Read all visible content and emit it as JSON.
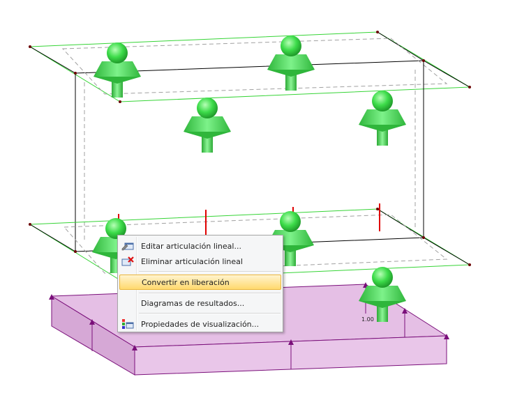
{
  "context_menu": {
    "items": [
      {
        "label": "Editar articulación lineal...",
        "icon": "edit-line-hinge-icon"
      },
      {
        "label": "Eliminar articulación lineal",
        "icon": "delete-line-hinge-icon"
      },
      {
        "label": "Convertir en liberación",
        "icon": "",
        "highlighted": true
      },
      {
        "label": "Diagramas de resultados...",
        "icon": ""
      },
      {
        "label": "Propiedades de visualización...",
        "icon": "display-properties-icon"
      }
    ]
  },
  "model": {
    "dimension_label": "1.00",
    "colors": {
      "support": "#3ddc4a",
      "support_dark": "#2fb63b",
      "edge": "#000000",
      "green_line": "#35d435",
      "dashed": "#a0a0a0",
      "load_arrow": "#7a0f7a",
      "load_fill": "#d9a9d9",
      "hinge_marker": "#e00000"
    }
  }
}
